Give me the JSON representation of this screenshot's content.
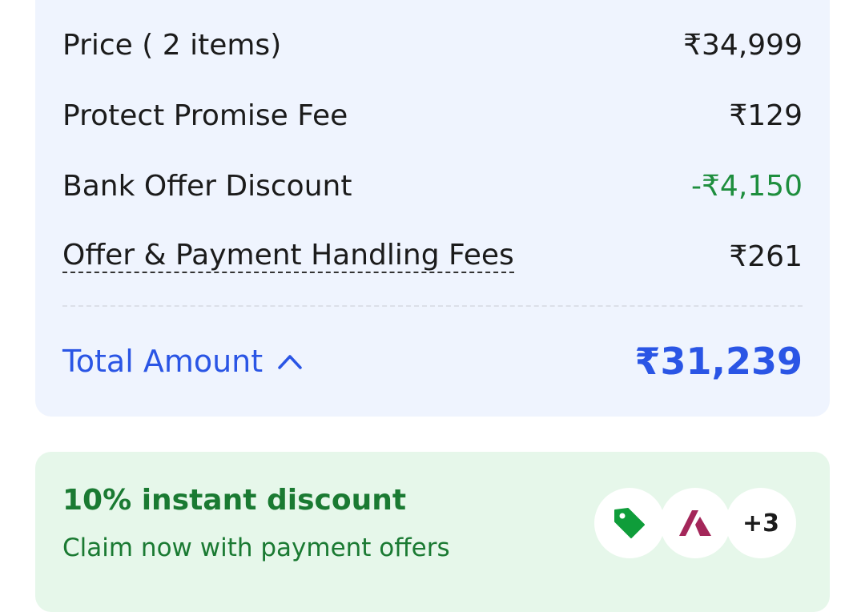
{
  "price_summary": {
    "rows": [
      {
        "label": "Price ( 2 items)",
        "value": "₹34,999"
      },
      {
        "label": "Protect Promise Fee",
        "value": "₹129"
      },
      {
        "label": "Bank Offer Discount",
        "value": "-₹4,150"
      },
      {
        "label": "Offer & Payment Handling Fees",
        "value": "₹261"
      }
    ],
    "total": {
      "label": "Total Amount",
      "value": "₹31,239",
      "icon": "chevron-up-icon"
    }
  },
  "offer_banner": {
    "title": "10% instant discount",
    "subtitle": "Claim now with payment offers",
    "more_count": "+3",
    "icons": [
      "price-tag-icon",
      "axis-bank-logo-icon"
    ]
  },
  "colors": {
    "card_bg": "#eff4fe",
    "accent_blue": "#2a55e5",
    "discount_green": "#1e8e3e",
    "offer_bg": "#e6f7ea",
    "offer_text": "#1a7a32"
  }
}
